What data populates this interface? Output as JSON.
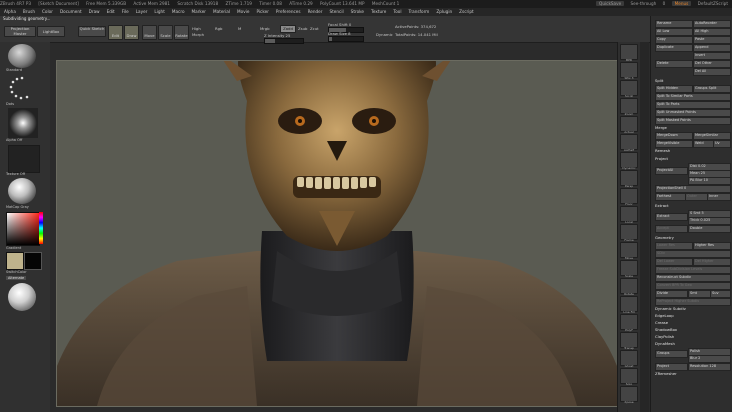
{
  "titlebar": {
    "app": "ZBrush 4R7 P3",
    "doc": "[Sketch Document]",
    "free_mem": "Free Mem 5.339GB",
    "active_mem": "Active Mem 2981",
    "scratch": "Scratch Disk 13918",
    "ztime": "ZTime 1.719",
    "timer": "Timer 0.08",
    "atime": "ATime 0.29",
    "polycount": "PolyCount 13.641 MP",
    "meshcount": "MeshCount 1",
    "quicksave": "QuickSave",
    "seethrough_label": "See-through",
    "seethrough_value": "0",
    "menus_btn": "Menus",
    "script_label": "DefaultZScript"
  },
  "status_line": "Subdividing geometry...",
  "menubar": [
    "Alpha",
    "Brush",
    "Color",
    "Document",
    "Draw",
    "Edit",
    "File",
    "Layer",
    "Light",
    "Macro",
    "Marker",
    "Material",
    "Movie",
    "Picker",
    "Preferences",
    "Render",
    "Stencil",
    "Stroke",
    "Texture",
    "Tool",
    "Transform",
    "Zplugin",
    "Zscript"
  ],
  "shelf": {
    "projection_master": "Projection Master",
    "lightbox": "LightBox",
    "quick_sketch": "Quick Sketch",
    "edit": "Edit",
    "draw": "Draw",
    "move": "Move",
    "scale": "Scale",
    "rotate": "Rotate",
    "morph": "Morph",
    "high": "High",
    "rgb": "Rgb",
    "m": "M",
    "mrgb": "Mrgb",
    "zadd": "Zadd",
    "zsub": "Zsub",
    "zcut": "Zcut",
    "focal_shift": "Focal Shift 0",
    "draw_size": "Draw Size 8",
    "dynamic": "Dynamic",
    "z_intensity": "Z Intensity 25",
    "active_points": "ActivePoints: 374,672",
    "total_points": "TotalPoints: 14.041 Mil"
  },
  "leftpanel": {
    "brush": "Standard",
    "stroke": "Dots",
    "alpha": "Alpha Off",
    "texture": "Texture Off",
    "material": "MatCap Gray",
    "gradient": "Gradient",
    "switch_color": "SwitchColor",
    "alternate": "Alternate"
  },
  "rightstrip": [
    "BPR",
    "SPix 3",
    "Scroll",
    "Zoom",
    "Actual",
    "AAHalf",
    "Dynamic",
    "Persp",
    "Floor",
    "Local",
    "Frame",
    "Move",
    "Scale",
    "Rotate",
    "Line Fill",
    "PolyF",
    "Transp",
    "Ghost",
    "Solo",
    "Xpose"
  ],
  "rightpanel": {
    "buttons_top": [
      [
        "Rename",
        "AutoReorder"
      ],
      [
        "All Low",
        "All High"
      ],
      [
        "Copy",
        "Paste"
      ],
      [
        "Duplicate",
        "Append"
      ],
      [
        "",
        "Insert"
      ],
      [
        "Delete",
        "Del Other"
      ],
      [
        "",
        "Del All"
      ]
    ],
    "split_head": "Split",
    "split": [
      "Split Hidden",
      "Groups Split",
      "Split To Similar Parts",
      "Split To Parts",
      "Split Unmasked Points",
      "Split Masked Points"
    ],
    "merge_head": "Merge",
    "merge": [
      [
        "MergeDown",
        "MergeSimilar"
      ],
      [
        "MergeVisible",
        "Weld",
        "Uv"
      ]
    ],
    "remesh": "Remesh",
    "project_head": "Project",
    "project_all": "ProjectAll",
    "dist": "Dist 0.02",
    "mean": "Mean 25",
    "pa_blur": "PA Blur 10",
    "projection_shell": "ProjectionShell 0",
    "farthest": "Farthest",
    "outer": "Outer",
    "inner": "Inner",
    "extract_head": "Extract",
    "extract": "Extract",
    "s_smt": "S Smt 5",
    "thick": "Thick 0.025",
    "accept": "Accept",
    "double": "Double",
    "geometry_head": "Geometry",
    "lower_res": "Lower Res",
    "higher_res": "Higher Res",
    "sdiv": "SDiv",
    "del_lower": "Del Lower",
    "del_higher": "Del Higher",
    "freeze": "Freeze SubDivision Levels",
    "reconstruct": "Reconstruct Subdiv",
    "convert": "Convert BPR To Geo",
    "divide": "Divide",
    "smt": "Smt",
    "suv": "Suv",
    "rsm": "ReProject Higher Subdiv",
    "dynamic_subdiv": "Dynamic Subdiv",
    "edgeloop": "EdgeLoop",
    "crease": "Crease",
    "shadowbox": "ShadowBox",
    "claypolish": "ClayPolish",
    "dynamesh": "DynaMesh",
    "groups": "Groups",
    "polish": "Polish",
    "blur": "Blur 2",
    "project_dm": "Project",
    "resolution": "Resolution 128",
    "zremesher": "ZRemesher"
  }
}
